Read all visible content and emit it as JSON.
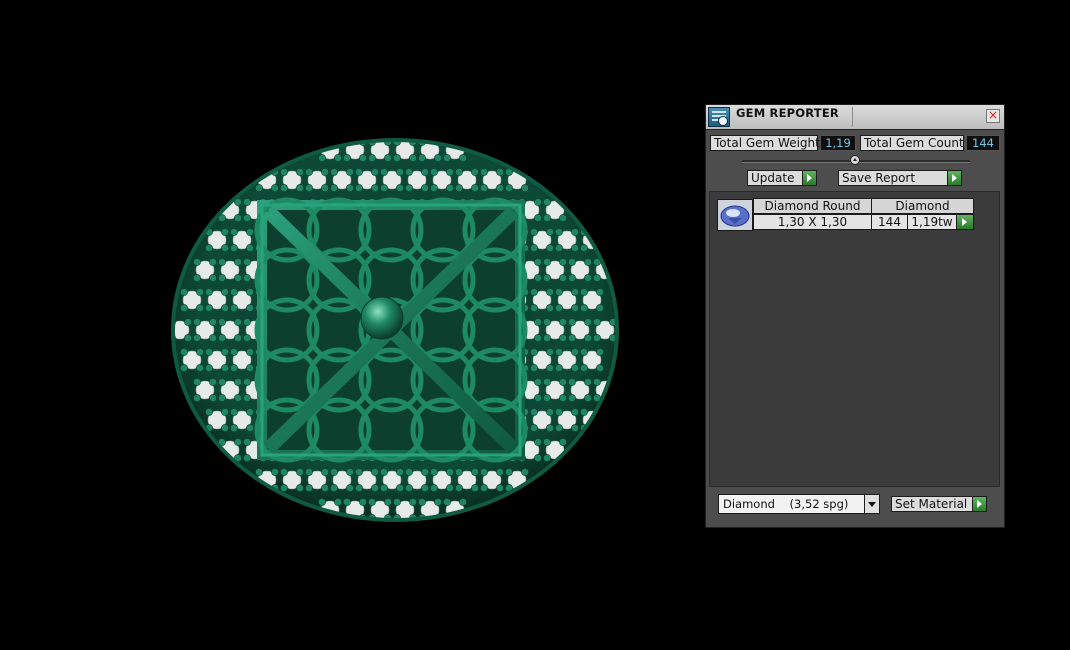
{
  "panel": {
    "title": "GEM REPORTER",
    "close_label": "×",
    "total_weight_label": "Total Gem Weight",
    "total_weight_value": "1,19",
    "total_count_label": "Total Gem Count",
    "total_count_value": "144",
    "update_label": "Update",
    "save_report_label": "Save Report",
    "table": {
      "headers": [
        "Diamond Round",
        "Diamond"
      ],
      "rows": [
        {
          "size": "1,30 X 1,30",
          "count": "144",
          "weight": "1,19tw"
        }
      ]
    },
    "material_select_value": "Diamond    (3,52 spg)",
    "set_material_label": "Set Material"
  },
  "colors": {
    "metal_green": "#1e7a5c",
    "gem_white": "#e8ecec",
    "panel_bg": "#4d4d4d",
    "value_text": "#6cc7e6"
  }
}
